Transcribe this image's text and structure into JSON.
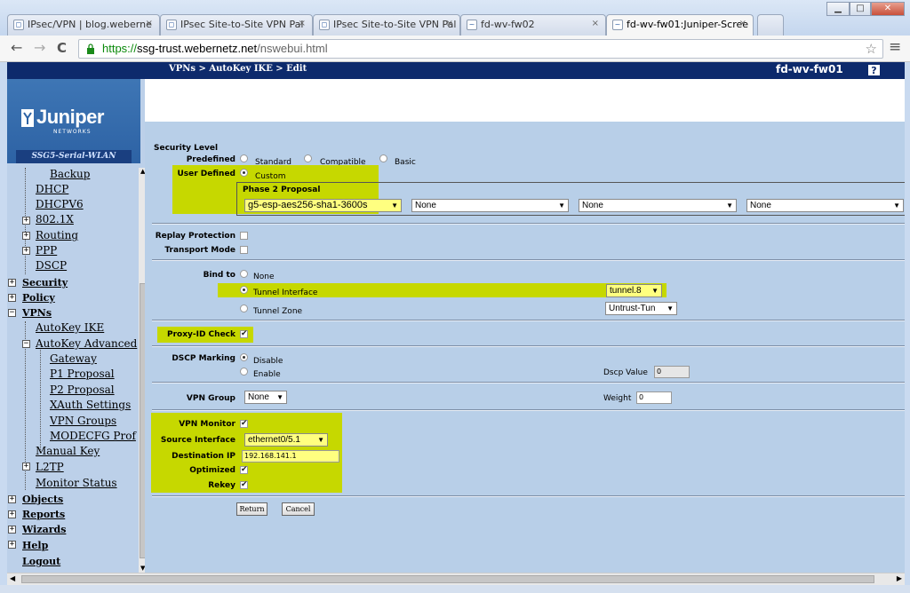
{
  "browser": {
    "tabs": [
      {
        "label": "IPsec/VPN | blog.weberne",
        "close": "×"
      },
      {
        "label": "IPsec Site-to-Site VPN Pal",
        "close": "×"
      },
      {
        "label": "IPsec Site-to-Site VPN Pal",
        "close": "×"
      },
      {
        "label": "fd-wv-fw02",
        "close": "×"
      },
      {
        "label": "fd-wv-fw01:Juniper-Scree",
        "close": "×"
      }
    ],
    "url_scheme": "https://",
    "url_host": "ssg-trust.webernetz.net",
    "url_path": "/nswebui.html",
    "back_icon": "←",
    "forward_icon": "→",
    "reload_icon": "C",
    "star_icon": "☆",
    "menu_icon": "≡",
    "min": "▁",
    "max": "□",
    "close": "✕"
  },
  "header": {
    "breadcrumb": "VPNs > AutoKey IKE > Edit",
    "device": "fd-wv-fw01",
    "help": "?"
  },
  "sidebar": {
    "logo": "Juniper",
    "logo_sub": "NETWORKS",
    "device_model": "SSG5-Serial-WLAN",
    "items": {
      "backup": "Backup",
      "dhcp": "DHCP",
      "dhcpv6": "DHCPV6",
      "dot1x": "802.1X",
      "routing": "Routing",
      "ppp": "PPP",
      "dscp": "DSCP",
      "security": "Security",
      "policy": "Policy",
      "vpns": "VPNs",
      "autokey_ike": "AutoKey IKE",
      "autokey_adv": "AutoKey Advanced",
      "gateway": "Gateway",
      "p1": "P1 Proposal",
      "p2": "P2 Proposal",
      "xauth": "XAuth Settings",
      "vpn_groups": "VPN Groups",
      "modecfg": "MODECFG Prof",
      "manual_key": "Manual Key",
      "l2tp": "L2TP",
      "monitor": "Monitor Status",
      "objects": "Objects",
      "reports": "Reports",
      "wizards": "Wizards",
      "help": "Help",
      "logout": "Logout"
    }
  },
  "form": {
    "security_level": "Security Level",
    "predefined": "Predefined",
    "standard": "Standard",
    "compatible": "Compatible",
    "basic": "Basic",
    "user_defined": "User Defined",
    "custom": "Custom",
    "phase2": "Phase 2 Proposal",
    "p2_1": "g5-esp-aes256-sha1-3600s",
    "p2_2": "None",
    "p2_3": "None",
    "p2_4": "None",
    "replay": "Replay Protection",
    "transport": "Transport Mode",
    "bind_to": "Bind to",
    "none": "None",
    "tunnel_iface": "Tunnel Interface",
    "tunnel_iface_val": "tunnel.8",
    "tunnel_zone": "Tunnel Zone",
    "tunnel_zone_val": "Untrust-Tun",
    "proxy_id": "Proxy-ID Check",
    "dscp_marking": "DSCP Marking",
    "disable": "Disable",
    "enable": "Enable",
    "dscp_value_lbl": "Dscp Value",
    "dscp_value": "0",
    "vpn_group": "VPN Group",
    "vpn_group_val": "None",
    "weight_lbl": "Weight",
    "weight": "0",
    "vpn_monitor": "VPN Monitor",
    "source_iface": "Source Interface",
    "source_iface_val": "ethernet0/5.1",
    "dest_ip": "Destination IP",
    "dest_ip_val": "192.168.141.1",
    "optimized": "Optimized",
    "rekey": "Rekey",
    "return_btn": "Return",
    "cancel_btn": "Cancel",
    "check": "✔",
    "arrow": "▼"
  },
  "colors": {
    "highlight": "#c6d800",
    "nav_dark": "#0d2a6c"
  }
}
